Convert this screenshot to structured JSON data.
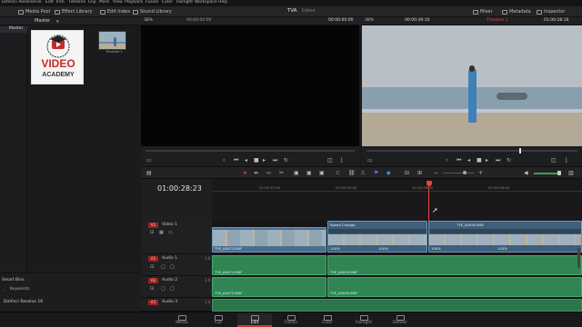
{
  "menu": [
    "DaVinci Resolve",
    "File",
    "Edit",
    "Trim",
    "Timeline",
    "Clip",
    "Mark",
    "View",
    "Playback",
    "Fusion",
    "Color",
    "Fairlight",
    "Workspace",
    "Help"
  ],
  "toolbar": {
    "left": [
      "Media Pool",
      "Effect Library",
      "Edit Index",
      "Sound Library"
    ],
    "project_title": "TVA",
    "project_status": "Edited",
    "right": [
      "Mixer",
      "Metadata",
      "Inspector"
    ]
  },
  "media_pool": {
    "bin_selector": "Master",
    "bin_list": [
      "Master"
    ],
    "clip_name": "Timeline 1",
    "smart_bins_label": "Smart Bins",
    "smart_bins_items": [
      "Keywords"
    ],
    "logo_text": [
      "VIDEO",
      "ACADEMY"
    ]
  },
  "viewers": {
    "source_zoom": "38%",
    "source_tc": "00:00:00:00",
    "source_tc2": "00:00:00:00",
    "timeline_zoom": "38%",
    "timeline_dur": "00:00:39:10",
    "timeline_name": "Timeline 1",
    "timeline_tc": "01:00:28:16"
  },
  "timeline": {
    "current_tc": "01:00:28:23",
    "ruler_labels": [
      "01:00:12:00",
      "01:00:20:00",
      "01:00:28:00",
      "01:00:36:00"
    ],
    "tracks": [
      {
        "badge": "V1",
        "name": "Video 1"
      },
      {
        "badge": "A1",
        "name": "Audio 1",
        "ch": "1.0"
      },
      {
        "badge": "A2",
        "name": "Audio 2",
        "ch": "1.0"
      },
      {
        "badge": "A3",
        "name": "Audio 3",
        "ch": "1.0"
      }
    ],
    "clips": {
      "v1a": "TYE_A0072.MXF",
      "speed_change": "Speed Change",
      "v1b": "TYE_A0050.MXF",
      "v1c": "TYE_A0050.MXF",
      "a1a": "TYE_A0072.MXF",
      "a1b": "TYE_A0050.MXF",
      "a2a": "TYE_A0072.MXF",
      "a2b": "TYE_A0050.MXF",
      "speed_pct": [
        "100%",
        "100%",
        "100%",
        "100%"
      ]
    }
  },
  "app_footer": {
    "name": "DaVinci Resolve 16"
  },
  "pages": [
    {
      "label": "Media",
      "active": false
    },
    {
      "label": "Cut",
      "active": false
    },
    {
      "label": "Edit",
      "active": true
    },
    {
      "label": "Fusion",
      "active": false
    },
    {
      "label": "Color",
      "active": false
    },
    {
      "label": "Fairlight",
      "active": false
    },
    {
      "label": "Deliver",
      "active": false
    }
  ],
  "colors": {
    "accent_red": "#d8342c",
    "video_clip": "#4b6e8c",
    "audio_clip": "#2f8653",
    "playhead": "#e8453c"
  }
}
